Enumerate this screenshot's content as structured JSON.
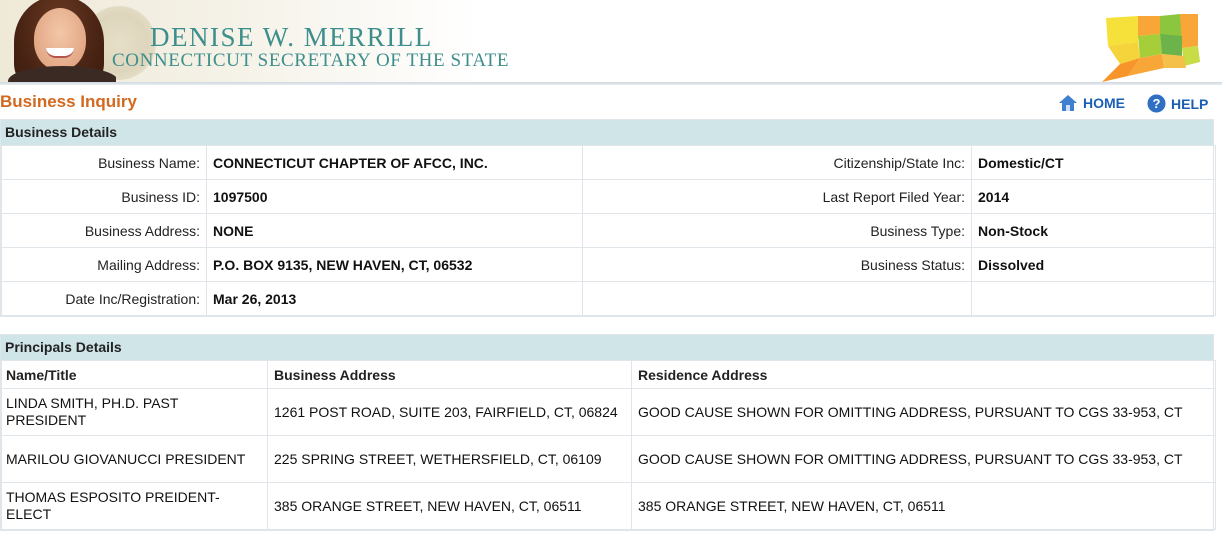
{
  "header": {
    "name": "DENISE W. MERRILL",
    "subtitle": "CONNECTICUT SECRETARY OF THE STATE"
  },
  "page_title": "Business Inquiry",
  "nav": {
    "home_label": "HOME",
    "help_label": "HELP"
  },
  "colors": {
    "accent_orange": "#d2691e",
    "brand_teal": "#3d8e8c",
    "link_blue": "#1a5fb4",
    "section_header_bg": "#cfe5e8"
  },
  "business_details": {
    "section_title": "Business Details",
    "rows": [
      {
        "left_label": "Business Name:",
        "left_value": "CONNECTICUT CHAPTER OF AFCC, INC.",
        "right_label": "Citizenship/State Inc:",
        "right_value": "Domestic/CT"
      },
      {
        "left_label": "Business ID:",
        "left_value": "1097500",
        "right_label": "Last Report Filed Year:",
        "right_value": "2014"
      },
      {
        "left_label": "Business Address:",
        "left_value": "NONE",
        "right_label": "Business Type:",
        "right_value": "Non-Stock"
      },
      {
        "left_label": "Mailing Address:",
        "left_value": "P.O. BOX 9135, NEW HAVEN, CT, 06532",
        "right_label": "Business Status:",
        "right_value": "Dissolved"
      },
      {
        "left_label": "Date Inc/Registration:",
        "left_value": "Mar 26, 2013",
        "right_label": "",
        "right_value": ""
      }
    ]
  },
  "principals_details": {
    "section_title": "Principals Details",
    "columns": [
      "Name/Title",
      "Business Address",
      "Residence Address"
    ],
    "rows": [
      {
        "name": "LINDA SMITH, PH.D.  PAST PRESIDENT",
        "business_address": "1261 POST ROAD, SUITE 203, FAIRFIELD, CT, 06824",
        "residence_address": "GOOD CAUSE SHOWN FOR OMITTING ADDRESS, PURSUANT TO CGS 33-953, CT"
      },
      {
        "name": "MARILOU GIOVANUCCI  PRESIDENT",
        "business_address": "225 SPRING STREET, WETHERSFIELD, CT, 06109",
        "residence_address": "GOOD CAUSE SHOWN FOR OMITTING ADDRESS, PURSUANT TO CGS 33-953, CT"
      },
      {
        "name": "THOMAS ESPOSITO  PREIDENT-ELECT",
        "business_address": "385 ORANGE STREET, NEW HAVEN, CT, 06511",
        "residence_address": "385 ORANGE STREET, NEW HAVEN, CT, 06511"
      }
    ]
  }
}
